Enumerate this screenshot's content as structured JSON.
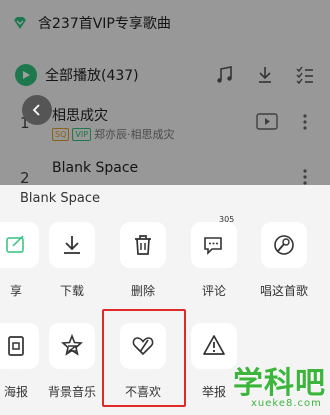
{
  "header": {
    "vip_text": "含237首VIP专享歌曲"
  },
  "playbar": {
    "label": "全部播放(437)"
  },
  "songs": [
    {
      "index": "1",
      "title": "相思成灾",
      "badges": [
        "SQ",
        "VIP"
      ],
      "meta": "郑亦辰·相思成灾"
    },
    {
      "index": "2",
      "title": "Blank Space"
    }
  ],
  "sheet": {
    "title": "Blank Space",
    "row1": [
      {
        "label": "享",
        "icon": "share-icon"
      },
      {
        "label": "下载",
        "icon": "download-icon"
      },
      {
        "label": "删除",
        "icon": "trash-icon"
      },
      {
        "label": "评论",
        "icon": "comment-icon",
        "count": "305"
      },
      {
        "label": "唱这首歌",
        "icon": "sing-icon"
      }
    ],
    "row2": [
      {
        "label": "海报",
        "icon": "poster-icon"
      },
      {
        "label": "背景音乐",
        "icon": "bgm-icon"
      },
      {
        "label": "不喜欢",
        "icon": "dislike-heart-icon"
      },
      {
        "label": "举报",
        "icon": "warning-icon"
      }
    ]
  },
  "watermark": {
    "main": "学科吧",
    "sub": "xueke8.com"
  },
  "colors": {
    "accent": "#31c27c",
    "highlight": "#e02a2a",
    "watermark": "#3bb53b"
  }
}
